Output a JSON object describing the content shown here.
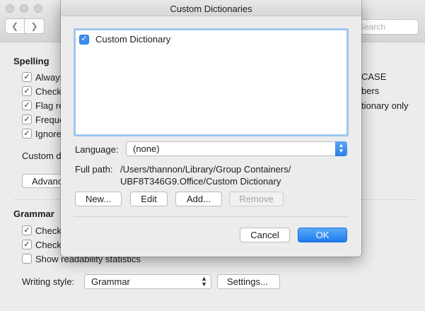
{
  "background": {
    "search_placeholder": "Search",
    "spelling": {
      "title": "Spelling",
      "options": [
        {
          "label": "Always",
          "checked": true
        },
        {
          "label": "Check",
          "checked": true
        },
        {
          "label": "Flag re",
          "checked": true
        },
        {
          "label": "Freque",
          "checked": true
        },
        {
          "label": "Ignore",
          "checked": true
        }
      ],
      "right_column": [
        "CASE",
        "bers",
        "tionary only"
      ],
      "custom_label": "Custom d",
      "advanced_button": "Advanc"
    },
    "grammar": {
      "title": "Grammar",
      "options": [
        {
          "label": "Check",
          "checked": true
        },
        {
          "label": "Check",
          "checked": true
        },
        {
          "label": "Show readability statistics",
          "checked": false
        }
      ],
      "writing_style_label": "Writing style:",
      "writing_style_value": "Grammar",
      "settings_button": "Settings..."
    }
  },
  "dialog": {
    "title": "Custom Dictionaries",
    "dictionaries": [
      {
        "name": "Custom Dictionary",
        "checked": true
      }
    ],
    "language_label": "Language:",
    "language_value": "(none)",
    "full_path_label": "Full path:",
    "full_path_line1": "/Users/thannon/Library/Group Containers/",
    "full_path_line2": "UBF8T346G9.Office/Custom Dictionary",
    "buttons": {
      "new": "New...",
      "edit": "Edit",
      "add": "Add...",
      "remove": "Remove",
      "cancel": "Cancel",
      "ok": "OK"
    }
  },
  "colors": {
    "accent": "#3b8ff0",
    "list_focus_ring": "#9fc6f0"
  }
}
